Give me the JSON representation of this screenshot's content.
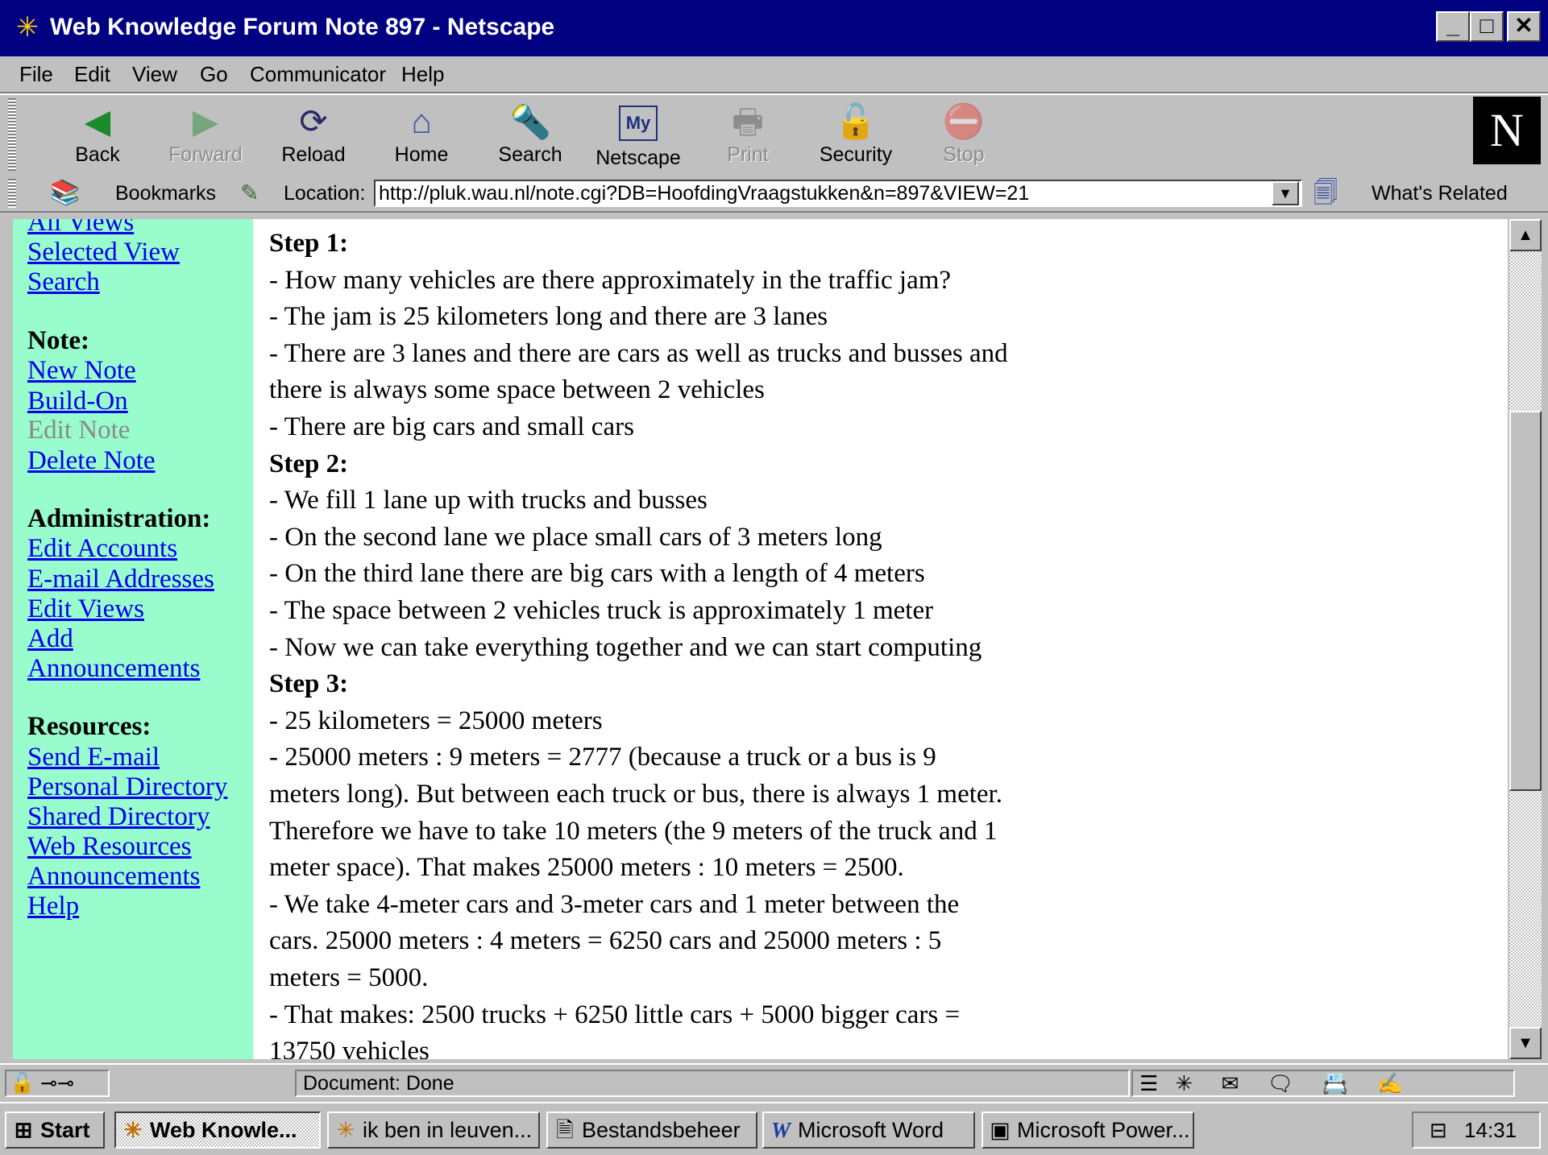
{
  "window": {
    "title": "Web Knowledge Forum Note 897 - Netscape",
    "app_icon": "wkf-icon",
    "controls": {
      "minimize": "_",
      "maximize": "□",
      "close": "✕"
    }
  },
  "menu": [
    "File",
    "Edit",
    "View",
    "Go",
    "Communicator",
    "Help"
  ],
  "toolbar": [
    {
      "label": "Back",
      "icon": "back-icon",
      "glyph": "◀",
      "color": "#1a8a2a",
      "enabled": true
    },
    {
      "label": "Forward",
      "icon": "forward-icon",
      "glyph": "▶",
      "color": "#1a8a2a",
      "enabled": false
    },
    {
      "label": "Reload",
      "icon": "reload-icon",
      "glyph": "⟳",
      "color": "#2a2a6a",
      "enabled": true
    },
    {
      "label": "Home",
      "icon": "home-icon",
      "glyph": "⌂",
      "color": "#3a5a9a",
      "enabled": true
    },
    {
      "label": "Search",
      "icon": "search-icon",
      "glyph": "🔦",
      "color": "#2040a0",
      "enabled": true
    },
    {
      "label": "Netscape",
      "icon": "my-netscape-icon",
      "glyph": "My",
      "color": "#203080",
      "enabled": true
    },
    {
      "label": "Print",
      "icon": "print-icon",
      "glyph": "🖶",
      "color": "#505050",
      "enabled": false
    },
    {
      "label": "Security",
      "icon": "security-lock-icon",
      "glyph": "🔓",
      "color": "#806000",
      "enabled": true
    },
    {
      "label": "Stop",
      "icon": "stop-icon",
      "glyph": "⛔",
      "color": "#a02020",
      "enabled": false
    }
  ],
  "locationbar": {
    "bookmarks_label": "Bookmarks",
    "location_label": "Location:",
    "url": "http://pluk.wau.nl/note.cgi?DB=HoofdingVraagstukken&n=897&VIEW=21",
    "whats_related": "What's Related"
  },
  "sidebar": {
    "items": [
      {
        "text": "All Views",
        "type": "link"
      },
      {
        "text": "Selected View",
        "type": "link"
      },
      {
        "text": "Search",
        "type": "link"
      },
      {
        "text": "Note:",
        "type": "heading"
      },
      {
        "text": "New Note",
        "type": "link"
      },
      {
        "text": "Build-On",
        "type": "link"
      },
      {
        "text": "Edit Note",
        "type": "disabled"
      },
      {
        "text": "Delete Note",
        "type": "link"
      },
      {
        "text": "Administration:",
        "type": "heading"
      },
      {
        "text": "Edit Accounts",
        "type": "link"
      },
      {
        "text": "E-mail Addresses",
        "type": "link"
      },
      {
        "text": "Edit Views",
        "type": "link"
      },
      {
        "text": "Add",
        "type": "link"
      },
      {
        "text": "Announcements",
        "type": "link"
      },
      {
        "text": "Resources:",
        "type": "heading"
      },
      {
        "text": "Send E-mail",
        "type": "link"
      },
      {
        "text": "Personal Directory",
        "type": "link"
      },
      {
        "text": "Shared Directory",
        "type": "link"
      },
      {
        "text": "Web Resources",
        "type": "link"
      },
      {
        "text": "Announcements",
        "type": "link"
      },
      {
        "text": "Help",
        "type": "link"
      }
    ]
  },
  "content": {
    "lines": [
      {
        "text": "Step 1:",
        "step": true
      },
      {
        "text": "- How many vehicles are there approximately in the traffic jam?"
      },
      {
        "text": "- The jam is 25 kilometers long and there are 3 lanes"
      },
      {
        "text": "- There are 3 lanes and there are cars as well as trucks and busses and"
      },
      {
        "text": "there is always some space between 2 vehicles"
      },
      {
        "text": "- There are big cars and small cars"
      },
      {
        "text": "Step 2:",
        "step": true
      },
      {
        "text": "- We fill 1 lane up with trucks and busses"
      },
      {
        "text": "- On the second lane we place small cars of 3 meters long"
      },
      {
        "text": "- On the third lane there are big cars with a length of 4 meters"
      },
      {
        "text": "- The space between 2 vehicles truck is approximately 1 meter"
      },
      {
        "text": "- Now we can take everything together and we can start computing"
      },
      {
        "text": "Step 3:",
        "step": true
      },
      {
        "text": "- 25 kilometers = 25000 meters"
      },
      {
        "text": "- 25000 meters : 9 meters = 2777 (because a truck or a bus is 9"
      },
      {
        "text": "meters long). But between each truck or bus, there is always 1 meter."
      },
      {
        "text": "Therefore we have to take 10 meters (the 9 meters of the truck and 1"
      },
      {
        "text": "meter space). That makes 25000 meters : 10 meters = 2500."
      },
      {
        "text": "- We take 4-meter cars and 3-meter cars and 1 meter between the"
      },
      {
        "text": "cars. 25000 meters : 4 meters = 6250 cars and 25000 meters : 5"
      },
      {
        "text": "meters = 5000."
      },
      {
        "text": "- That makes: 2500 trucks + 6250 little cars + 5000 bigger cars ="
      },
      {
        "text": "13750 vehicles"
      }
    ]
  },
  "status": {
    "text": "Document: Done"
  },
  "taskbar": {
    "start": "Start",
    "tasks": [
      {
        "label": "Web Knowle...",
        "icon": "netscape-task-icon",
        "glyph": "✳",
        "active": true
      },
      {
        "label": "ik ben in leuven...",
        "icon": "netscape-task-icon",
        "glyph": "✳",
        "active": false
      },
      {
        "label": "Bestandsbeheer",
        "icon": "file-manager-icon",
        "glyph": "🗎",
        "active": false
      },
      {
        "label": "Microsoft Word",
        "icon": "word-icon",
        "glyph": "W",
        "active": false
      },
      {
        "label": "Microsoft Power...",
        "icon": "powerpoint-icon",
        "glyph": "▣",
        "active": false
      }
    ],
    "clock": "14:31"
  }
}
